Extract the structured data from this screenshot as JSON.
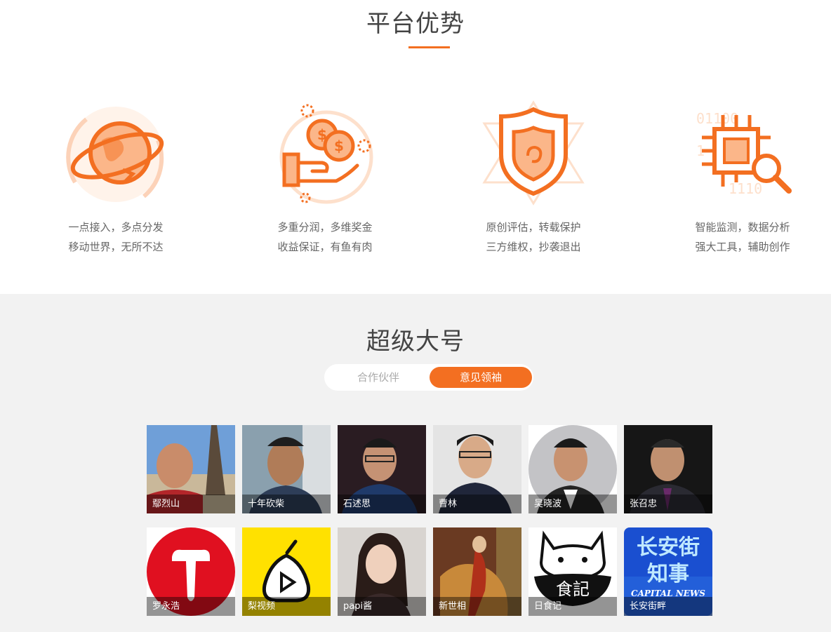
{
  "advantages": {
    "title": "平台优势",
    "items": [
      {
        "icon": "globe-orbit-icon",
        "line1": "一点接入，多点分发",
        "line2": "移动世界，无所不达"
      },
      {
        "icon": "coins-hand-icon",
        "line1": "多重分润，多维奖金",
        "line2": "收益保证，有鱼有肉"
      },
      {
        "icon": "shield-icon",
        "line1": "原创评估，转载保护",
        "line2": "三方维权，抄袭退出"
      },
      {
        "icon": "chip-search-icon",
        "line1": "智能监测，数据分析",
        "line2": "强大工具，辅助创作"
      }
    ]
  },
  "big_accounts": {
    "title": "超级大号",
    "tabs": [
      {
        "label": "合作伙伴",
        "active": false
      },
      {
        "label": "意见领袖",
        "active": true
      }
    ],
    "cards": [
      {
        "name": "鄢烈山"
      },
      {
        "name": "十年砍柴"
      },
      {
        "name": "石述思"
      },
      {
        "name": "曹林"
      },
      {
        "name": "吴晓波"
      },
      {
        "name": "张召忠"
      },
      {
        "name": "罗永浩"
      },
      {
        "name": "梨视频"
      },
      {
        "name": "papi酱"
      },
      {
        "name": "新世相"
      },
      {
        "name": "日食记"
      },
      {
        "name": "长安街畔"
      }
    ],
    "logo_texts": {
      "changan_line1": "长安街",
      "changan_line2": "知事",
      "changan_line3": "CAPITAL NEWS",
      "rishiji": "食記"
    }
  },
  "colors": {
    "accent": "#f36f21",
    "light_accent": "#fcd2b8",
    "section_bg": "#f2f2f2"
  }
}
